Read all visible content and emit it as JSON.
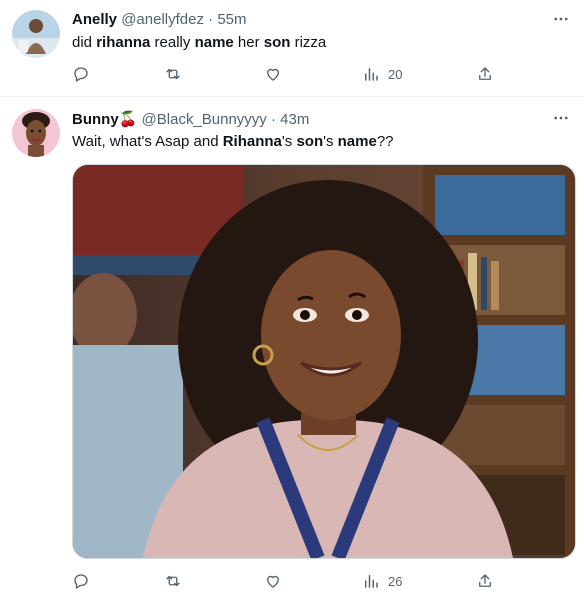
{
  "tweets": [
    {
      "name": "Anelly",
      "handle": "@anellyfdez",
      "separator": "·",
      "time": "55m",
      "text_parts": [
        "did ",
        "rihanna",
        " really ",
        "name",
        " her ",
        "son",
        " rizza"
      ],
      "views": "20"
    },
    {
      "name": "Bunny",
      "emoji": "🍒",
      "handle": "@Black_Bunnyyyy",
      "separator": "·",
      "time": "43m",
      "text_parts": [
        "Wait, what's Asap and ",
        "Rihanna",
        "'s ",
        "son",
        "'s ",
        "name",
        "??"
      ],
      "views": "26"
    }
  ],
  "icons": [
    "reply-icon",
    "retweet-icon",
    "like-icon",
    "views-icon",
    "share-icon",
    "more-icon"
  ],
  "colors": {
    "text": "#0f1419",
    "secondary": "#536471",
    "divider": "#eff3f4"
  }
}
